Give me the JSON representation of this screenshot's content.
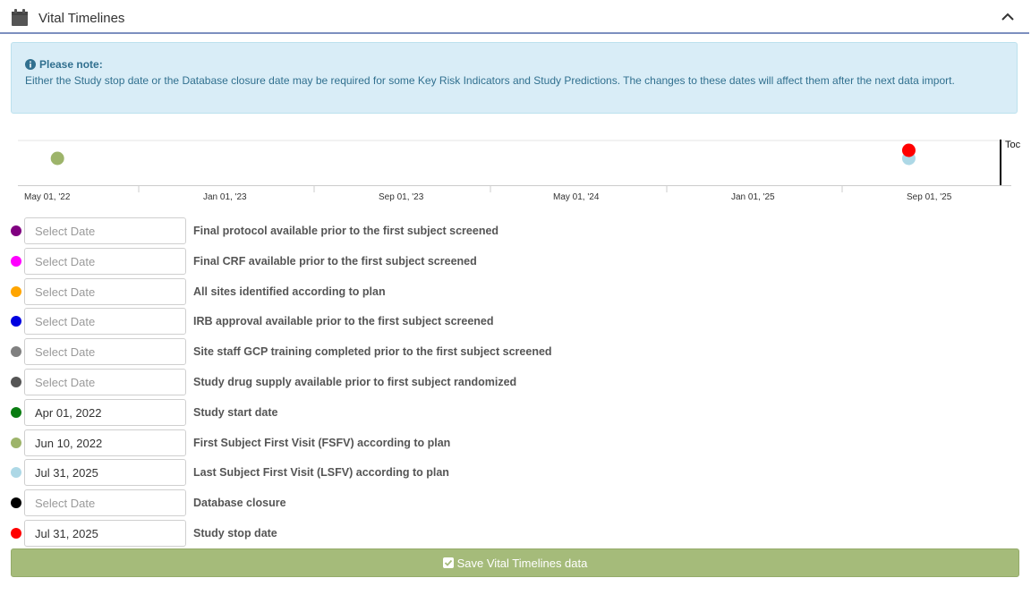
{
  "panel": {
    "title": "Vital Timelines",
    "collapse_icon": "chevron-up-icon",
    "title_icon": "calendar-icon"
  },
  "note": {
    "title": "Please note:",
    "text": "Either the Study stop date or the Database closure date may be required for some Key Risk Indicators and Study Predictions. The changes to these dates will affect them after the next data import."
  },
  "timeline": {
    "ticks": [
      "May 01, '22",
      "Jan 01, '23",
      "Sep 01, '23",
      "May 01, '24",
      "Jan 01, '25",
      "Sep 01, '25"
    ],
    "today_label": "Toc",
    "markers": [
      {
        "date": "2022-04-01",
        "color": "#0a7d12",
        "lane": 2
      },
      {
        "date": "2022-06-10",
        "color": "#9db46a",
        "lane": 1
      },
      {
        "date": "2025-07-31",
        "color": "#add8e6",
        "lane": 1
      },
      {
        "date": "2025-07-31",
        "color": "#ff0000",
        "lane": 0
      }
    ]
  },
  "milestones": [
    {
      "label": "Final protocol available prior to the first subject screened",
      "value": "",
      "color": "#800080"
    },
    {
      "label": "Final CRF available prior to the first subject screened",
      "value": "",
      "color": "#ff00ff"
    },
    {
      "label": "All sites identified according to plan",
      "value": "",
      "color": "#ffa500"
    },
    {
      "label": "IRB approval available prior to the first subject screened",
      "value": "",
      "color": "#0000e0"
    },
    {
      "label": "Site staff GCP training completed prior to the first subject screened",
      "value": "",
      "color": "#808080"
    },
    {
      "label": "Study drug supply available prior to first subject randomized",
      "value": "",
      "color": "#555555"
    },
    {
      "label": "Study start date",
      "value": "Apr 01, 2022",
      "color": "#0a7d12"
    },
    {
      "label": "First Subject First Visit (FSFV) according to plan",
      "value": "Jun 10, 2022",
      "color": "#9db46a"
    },
    {
      "label": "Last Subject First Visit (LSFV) according to plan",
      "value": "Jul 31, 2025",
      "color": "#add8e6"
    },
    {
      "label": "Database closure",
      "value": "",
      "color": "#000000"
    },
    {
      "label": "Study stop date",
      "value": "Jul 31, 2025",
      "color": "#ff0000"
    }
  ],
  "date_placeholder": "Select Date",
  "save_button": {
    "label": "Save Vital Timelines data",
    "icon": "checkbox-check-icon"
  }
}
